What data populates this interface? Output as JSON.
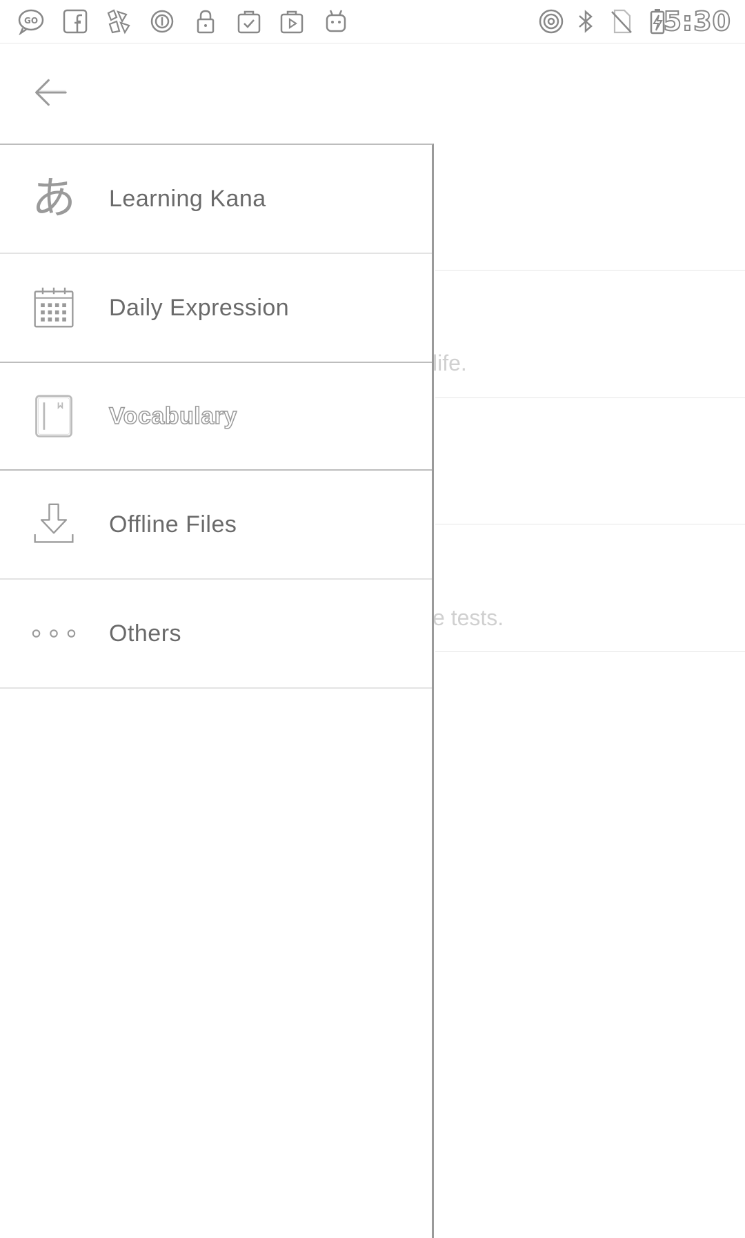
{
  "status_bar": {
    "left_icons": [
      "go-sms-icon",
      "facebook-icon",
      "app-icon",
      "sync-icon",
      "lock-icon",
      "clipboard-check-icon",
      "play-bag-icon",
      "android-icon"
    ],
    "right_icons": [
      "hotspot-icon",
      "bluetooth-icon",
      "no-sim-icon",
      "battery-charging-icon"
    ],
    "time": "5:30"
  },
  "app_bar": {
    "back_icon": "arrow-back-icon"
  },
  "background": {
    "snippet_1": "life.",
    "snippet_2": "e tests."
  },
  "drawer": {
    "items": [
      {
        "label": "Learning Kana",
        "icon": "kana-icon",
        "glyph": "あ"
      },
      {
        "label": "Daily Expression",
        "icon": "calendar-icon"
      },
      {
        "label": "Vocabulary",
        "icon": "notebook-icon",
        "selected": true
      },
      {
        "label": "Offline Files",
        "icon": "download-icon"
      },
      {
        "label": "Others",
        "icon": "more-dots-icon"
      }
    ]
  },
  "colors": {
    "background": "#ffffff",
    "icon_gray": "#9a9a9a",
    "text_gray": "#6a6a6a",
    "divider": "#e3e3e3",
    "drawer_edge": "#9a9a9a"
  }
}
